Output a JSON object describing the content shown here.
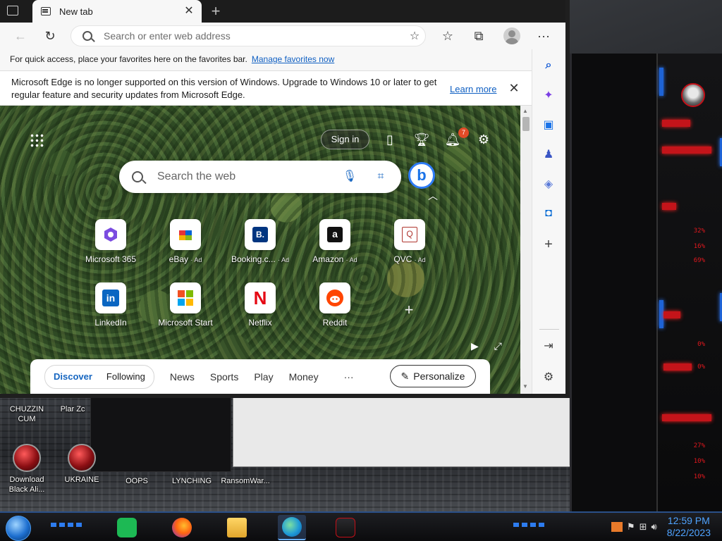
{
  "browser": {
    "tab": {
      "title": "New tab"
    },
    "address": {
      "placeholder": "Search or enter web address"
    },
    "favbar": {
      "text": "For quick access, place your favorites here on the favorites bar.",
      "link": "Manage favorites now"
    },
    "infobar": {
      "message": "Microsoft Edge is no longer supported on this version of Windows. Upgrade to Windows 10 or later to get regular feature and security updates from Microsoft Edge.",
      "link": "Learn more"
    },
    "sidebar": [
      "search-icon",
      "copilot-icon",
      "tools-icon",
      "people-icon",
      "office-icon",
      "outlook-icon",
      "add-icon",
      "split-icon",
      "settings-icon"
    ]
  },
  "newtab": {
    "signin": "Sign in",
    "notifications_count": "7",
    "search_placeholder": "Search the web",
    "tiles": [
      {
        "label": "Microsoft 365",
        "ad": ""
      },
      {
        "label": "eBay",
        "ad": "· Ad"
      },
      {
        "label": "Booking.c...",
        "ad": "· Ad"
      },
      {
        "label": "Amazon",
        "ad": "· Ad"
      },
      {
        "label": "QVC",
        "ad": "· Ad"
      },
      {
        "label": "LinkedIn",
        "ad": ""
      },
      {
        "label": "Microsoft Start",
        "ad": ""
      },
      {
        "label": "Netflix",
        "ad": ""
      },
      {
        "label": "Reddit",
        "ad": ""
      }
    ],
    "feed": {
      "discover": "Discover",
      "following": "Following",
      "items": [
        "News",
        "Sports",
        "Play",
        "Money"
      ],
      "more": "···",
      "personalize": "Personalize"
    }
  },
  "desktop": {
    "icons": [
      {
        "label": "CHUZZIN CUM"
      },
      {
        "label": "Plar Zc"
      },
      {
        "label": "Download Black Ali..."
      },
      {
        "label": "UKRAINE"
      },
      {
        "label": "OOPS"
      },
      {
        "label": "LYNCHING"
      },
      {
        "label": "RansomWar..."
      }
    ],
    "gauges": [
      "32%",
      "16%",
      "69%",
      "0%",
      "0%",
      "27%",
      "10%",
      "10%"
    ]
  },
  "taskbar": {
    "clock": {
      "time": "12:59 PM",
      "date": "8/22/2023"
    },
    "apps": [
      "spotify-icon",
      "firefox-icon",
      "file-explorer-icon",
      "edge-icon",
      "alienware-icon"
    ]
  }
}
